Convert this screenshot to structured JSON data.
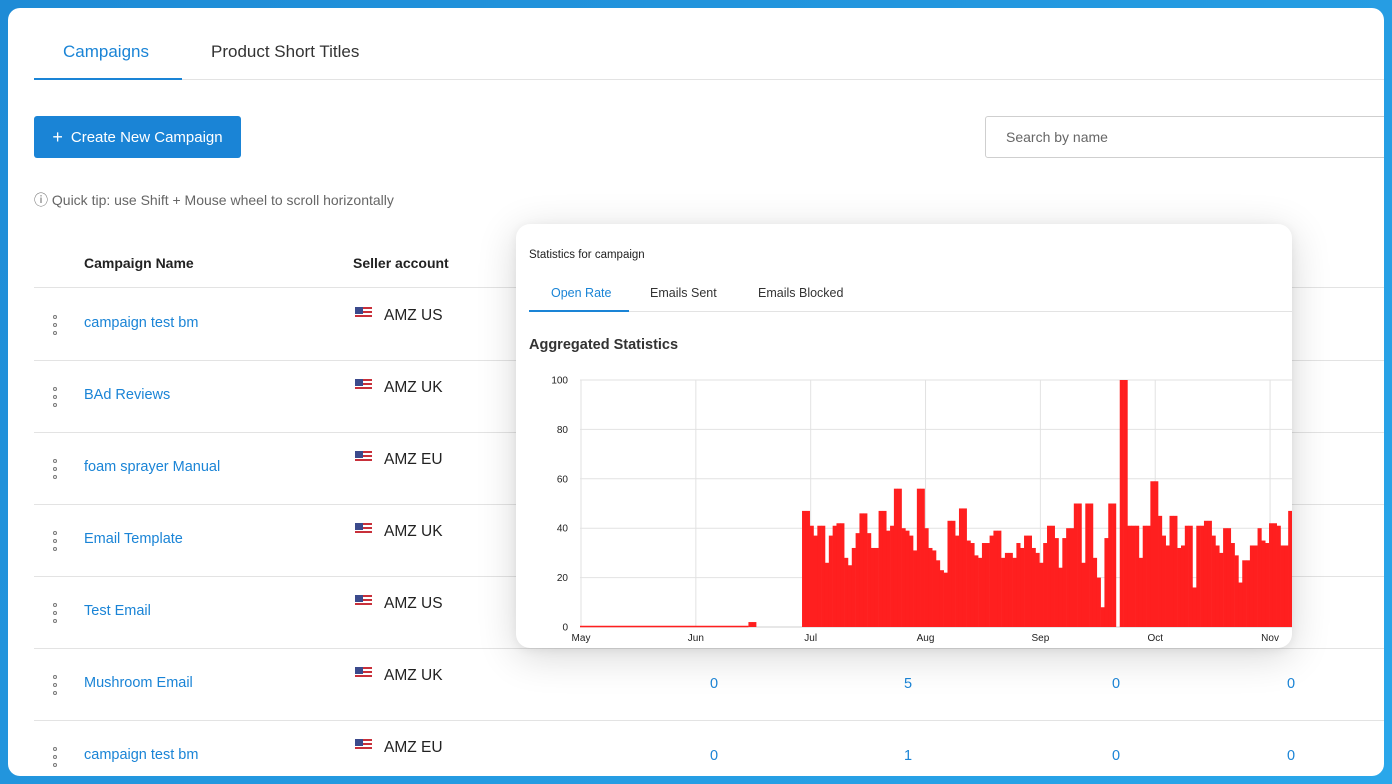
{
  "tabs": [
    {
      "label": "Campaigns",
      "active": true
    },
    {
      "label": "Product Short Titles",
      "active": false
    }
  ],
  "toolbar": {
    "create_button_label": "Create New Campaign",
    "search_placeholder": "Search by name",
    "tip": "ⓘ Quick tip: use Shift + Mouse wheel to scroll horizontally"
  },
  "table": {
    "headers": {
      "name": "Campaign Name",
      "seller": "Seller account"
    },
    "rows": [
      {
        "name": "campaign test bm",
        "seller": "AMZ US",
        "stats": []
      },
      {
        "name": "BAd Reviews",
        "seller": "AMZ UK",
        "stats": []
      },
      {
        "name": "foam sprayer Manual",
        "seller": "AMZ EU",
        "stats": []
      },
      {
        "name": "Email Template",
        "seller": "AMZ UK",
        "stats": []
      },
      {
        "name": "Test Email",
        "seller": "AMZ US",
        "stats": []
      },
      {
        "name": "Mushroom Email",
        "seller": "AMZ UK",
        "stats": [
          "0",
          "5",
          "0",
          "0"
        ]
      },
      {
        "name": "campaign test bm",
        "seller": "AMZ EU",
        "stats": [
          "0",
          "1",
          "0",
          "0"
        ]
      }
    ]
  },
  "popup": {
    "title": "Statistics for campaign",
    "tabs": [
      {
        "label": "Open Rate",
        "active": true
      },
      {
        "label": "Emails Sent",
        "active": false
      },
      {
        "label": "Emails Blocked",
        "active": false
      }
    ],
    "chart_heading": "Aggregated Statistics"
  },
  "chart_data": {
    "type": "bar",
    "title": "",
    "xlabel": "",
    "ylabel": "",
    "ylim": [
      0,
      100
    ],
    "yticks": [
      0,
      20,
      40,
      60,
      80,
      100
    ],
    "xtick_labels": [
      "May",
      "Jun",
      "Jul",
      "Aug",
      "Sep",
      "Oct",
      "Nov"
    ],
    "color": "#ff1f1f",
    "grid": true,
    "series": [
      {
        "values": [
          0,
          0,
          0,
          0,
          0,
          0,
          0,
          0,
          0,
          0,
          0,
          0,
          0,
          0,
          0,
          0,
          0,
          0,
          0,
          0,
          0,
          0,
          0,
          0,
          0,
          0,
          0,
          0,
          0,
          0,
          0,
          0,
          0,
          0,
          0,
          0,
          0,
          0,
          0,
          0,
          0,
          0,
          0,
          0,
          2,
          2,
          0,
          0,
          0,
          0,
          0,
          0,
          0,
          0,
          0,
          0,
          0,
          0,
          47,
          47,
          41,
          37,
          41,
          41,
          26,
          37,
          41,
          42,
          42,
          28,
          25,
          32,
          38,
          46,
          46,
          38,
          32,
          32,
          47,
          47,
          39,
          41,
          56,
          56,
          40,
          39,
          37,
          31,
          56,
          56,
          40,
          32,
          31,
          27,
          23,
          22,
          43,
          43,
          37,
          48,
          48,
          35,
          34,
          29,
          28,
          34,
          34,
          37,
          39,
          39,
          28,
          30,
          30,
          28,
          34,
          32,
          37,
          37,
          32,
          30,
          26,
          34,
          41,
          41,
          36,
          24,
          36,
          40,
          40,
          50,
          50,
          26,
          50,
          50,
          28,
          20,
          8,
          36,
          50,
          50,
          0,
          100,
          100,
          41,
          41,
          41,
          28,
          41,
          41,
          59,
          59,
          45,
          37,
          33,
          45,
          45,
          32,
          33,
          41,
          41,
          16,
          41,
          41,
          43,
          43,
          37,
          33,
          30,
          40,
          40,
          34,
          29,
          18,
          27,
          27,
          33,
          33,
          40,
          35,
          34,
          42,
          42,
          41,
          33,
          33,
          47
        ]
      }
    ]
  }
}
